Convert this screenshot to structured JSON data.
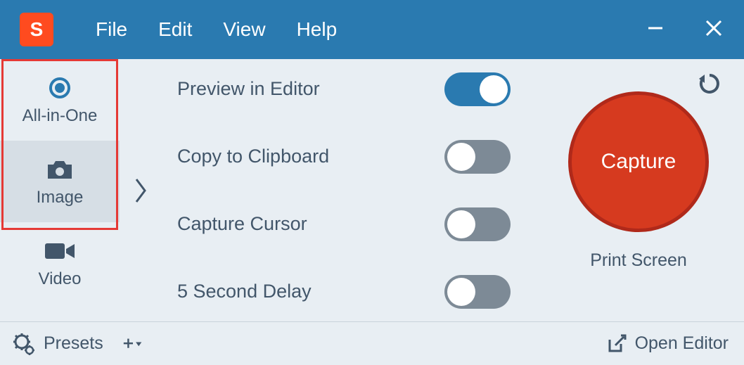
{
  "logo_letter": "S",
  "menu": {
    "file": "File",
    "edit": "Edit",
    "view": "View",
    "help": "Help"
  },
  "sidebar": {
    "all_in_one": "All-in-One",
    "image": "Image",
    "video": "Video"
  },
  "options": {
    "preview": {
      "label": "Preview in Editor",
      "on": true
    },
    "clipboard": {
      "label": "Copy to Clipboard",
      "on": false
    },
    "cursor": {
      "label": "Capture Cursor",
      "on": false
    },
    "delay": {
      "label": "5 Second Delay",
      "on": false
    }
  },
  "capture": {
    "button": "Capture",
    "shortcut": "Print Screen"
  },
  "footer": {
    "presets": "Presets",
    "open_editor": "Open Editor"
  }
}
